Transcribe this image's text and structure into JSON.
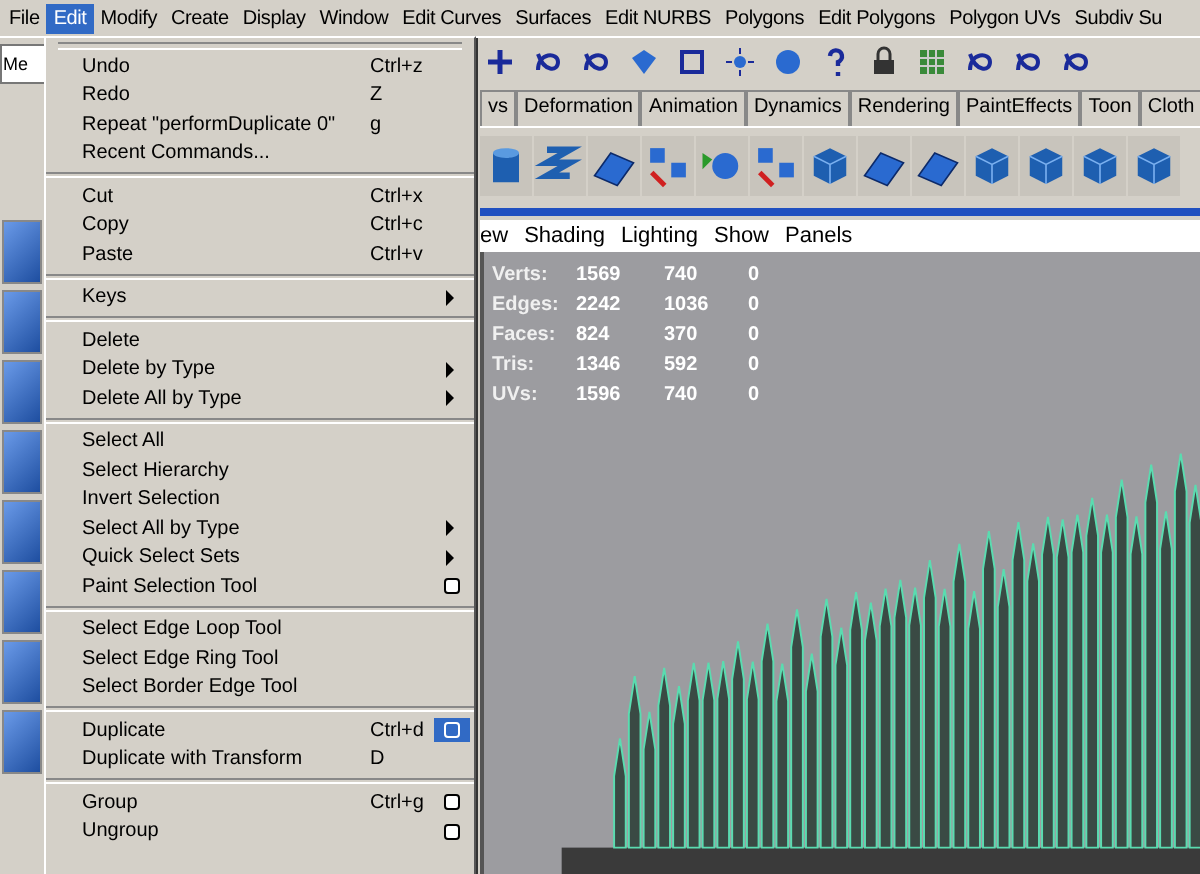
{
  "menu_bar": [
    {
      "label": "File",
      "selected": false
    },
    {
      "label": "Edit",
      "selected": true
    },
    {
      "label": "Modify",
      "selected": false
    },
    {
      "label": "Create",
      "selected": false
    },
    {
      "label": "Display",
      "selected": false
    },
    {
      "label": "Window",
      "selected": false
    },
    {
      "label": "Edit Curves",
      "selected": false
    },
    {
      "label": "Surfaces",
      "selected": false
    },
    {
      "label": "Edit NURBS",
      "selected": false
    },
    {
      "label": "Polygons",
      "selected": false
    },
    {
      "label": "Edit Polygons",
      "selected": false
    },
    {
      "label": "Polygon UVs",
      "selected": false
    },
    {
      "label": "Subdiv Su",
      "selected": false
    }
  ],
  "mode_field": {
    "value": "Me"
  },
  "shelf_tabs": [
    {
      "label": "vs",
      "selected": false
    },
    {
      "label": "Deformation",
      "selected": false
    },
    {
      "label": "Animation",
      "selected": false
    },
    {
      "label": "Dynamics",
      "selected": false
    },
    {
      "label": "Rendering",
      "selected": false
    },
    {
      "label": "PaintEffects",
      "selected": false
    },
    {
      "label": "Toon",
      "selected": false
    },
    {
      "label": "Cloth",
      "selected": false
    }
  ],
  "viewport": {
    "menu": [
      "ew",
      "Shading",
      "Lighting",
      "Show",
      "Panels"
    ],
    "hud": [
      {
        "label": "Verts:",
        "values": [
          "1569",
          "740",
          "0"
        ]
      },
      {
        "label": "Edges:",
        "values": [
          "2242",
          "1036",
          "0"
        ]
      },
      {
        "label": "Faces:",
        "values": [
          "824",
          "370",
          "0"
        ]
      },
      {
        "label": "Tris:",
        "values": [
          "1346",
          "592",
          "0"
        ]
      },
      {
        "label": "UVs:",
        "values": [
          "1596",
          "740",
          "0"
        ]
      }
    ]
  },
  "edit_menu": {
    "groups": [
      [
        {
          "label": "Undo",
          "shortcut": "Ctrl+z"
        },
        {
          "label": "Redo",
          "shortcut": "Z"
        },
        {
          "label": "Repeat \"performDuplicate 0\"",
          "shortcut": "g"
        },
        {
          "label": "Recent Commands..."
        }
      ],
      [
        {
          "label": "Cut",
          "shortcut": "Ctrl+x"
        },
        {
          "label": "Copy",
          "shortcut": "Ctrl+c"
        },
        {
          "label": "Paste",
          "shortcut": "Ctrl+v"
        }
      ],
      [
        {
          "label": "Keys",
          "submenu": true
        }
      ],
      [
        {
          "label": "Delete"
        },
        {
          "label": "Delete by Type",
          "submenu": true
        },
        {
          "label": "Delete All by Type",
          "submenu": true
        }
      ],
      [
        {
          "label": "Select All"
        },
        {
          "label": "Select Hierarchy"
        },
        {
          "label": "Invert Selection"
        },
        {
          "label": "Select All by Type",
          "submenu": true
        },
        {
          "label": "Quick Select Sets",
          "submenu": true
        },
        {
          "label": "Paint Selection Tool",
          "option_box": true,
          "option_box_selected": false
        }
      ],
      [
        {
          "label": "Select Edge Loop Tool"
        },
        {
          "label": "Select Edge Ring Tool"
        },
        {
          "label": "Select Border Edge Tool"
        }
      ],
      [
        {
          "label": "Duplicate",
          "shortcut": "Ctrl+d",
          "option_box": true,
          "option_box_selected": true
        },
        {
          "label": "Duplicate with Transform",
          "shortcut": "D"
        }
      ],
      [
        {
          "label": "Group",
          "shortcut": "Ctrl+g",
          "option_box": true,
          "option_box_selected": false
        },
        {
          "label": "Ungroup",
          "option_box": true,
          "option_box_selected": false
        }
      ]
    ]
  }
}
